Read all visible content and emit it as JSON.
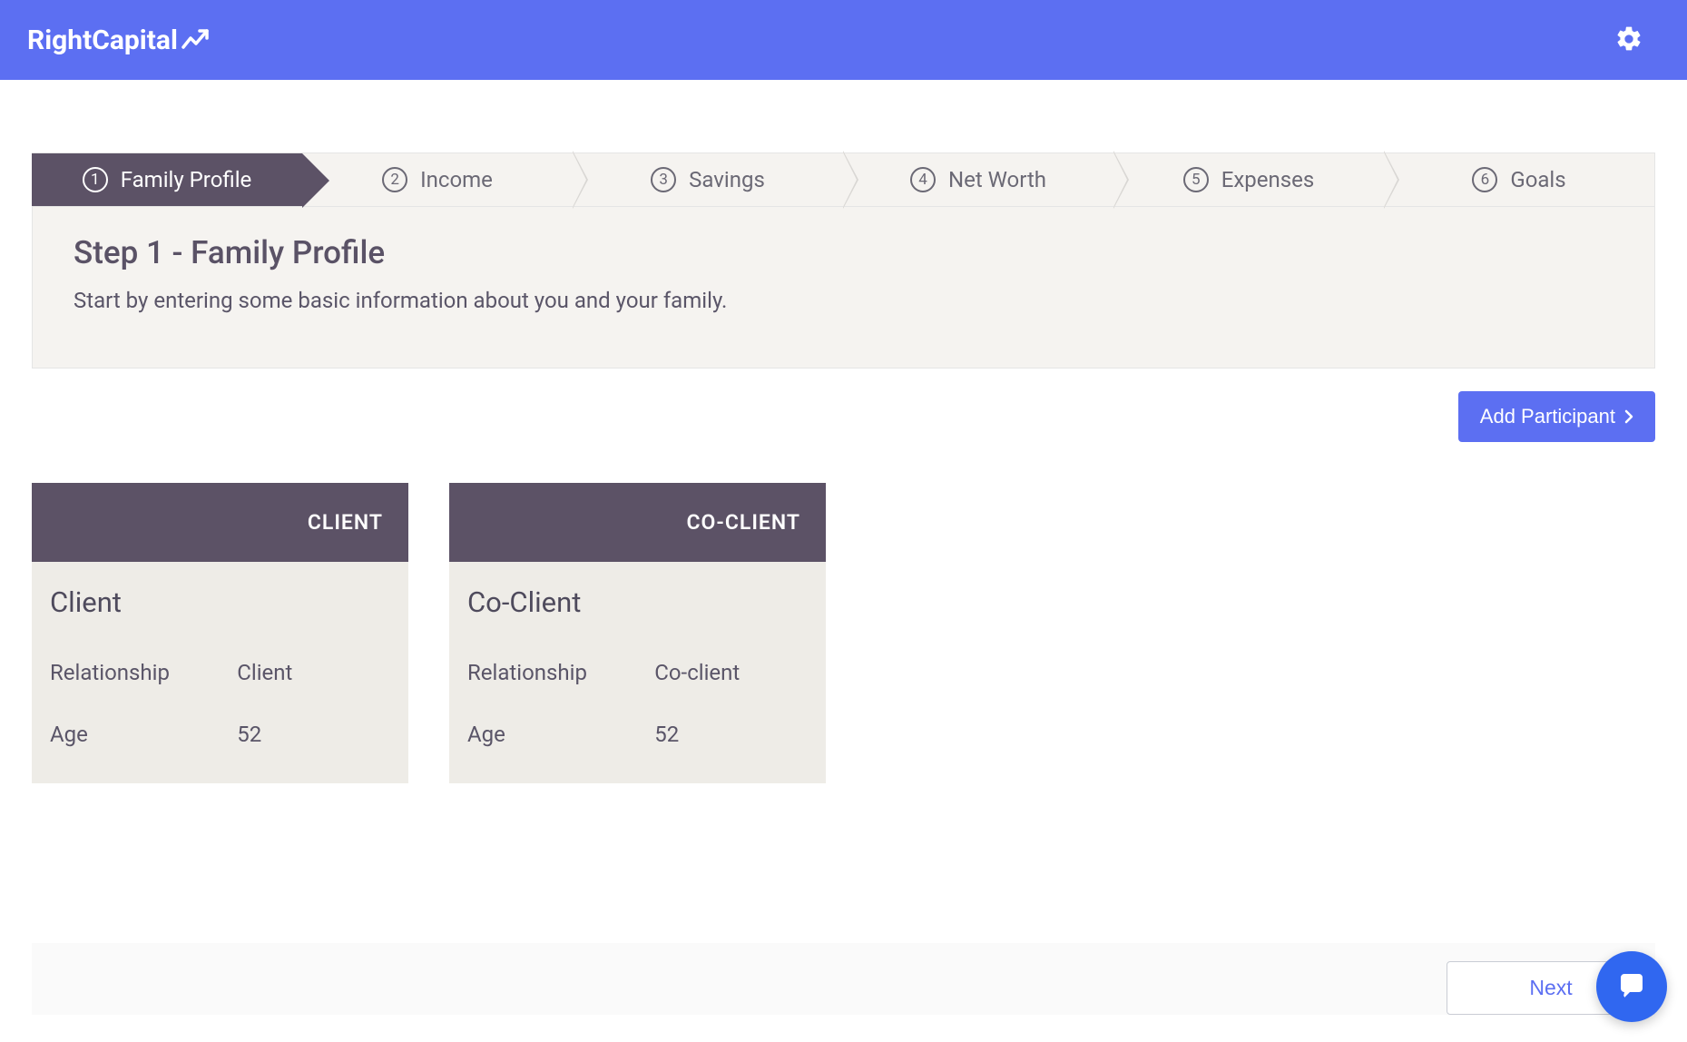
{
  "header": {
    "logo_text": "RightCapital"
  },
  "stepper": {
    "steps": [
      {
        "num": "1",
        "label": "Family Profile",
        "active": true
      },
      {
        "num": "2",
        "label": "Income",
        "active": false
      },
      {
        "num": "3",
        "label": "Savings",
        "active": false
      },
      {
        "num": "4",
        "label": "Net Worth",
        "active": false
      },
      {
        "num": "5",
        "label": "Expenses",
        "active": false
      },
      {
        "num": "6",
        "label": "Goals",
        "active": false
      }
    ]
  },
  "intro": {
    "title": "Step 1 - Family Profile",
    "subtitle": "Start by entering some basic information about you and your family."
  },
  "actions": {
    "add_participant_label": "Add Participant",
    "next_label": "Next"
  },
  "cards": [
    {
      "header": "CLIENT",
      "title": "Client",
      "relationship_label": "Relationship",
      "relationship_value": "Client",
      "age_label": "Age",
      "age_value": "52"
    },
    {
      "header": "CO-CLIENT",
      "title": "Co-Client",
      "relationship_label": "Relationship",
      "relationship_value": "Co-client",
      "age_label": "Age",
      "age_value": "52"
    }
  ]
}
